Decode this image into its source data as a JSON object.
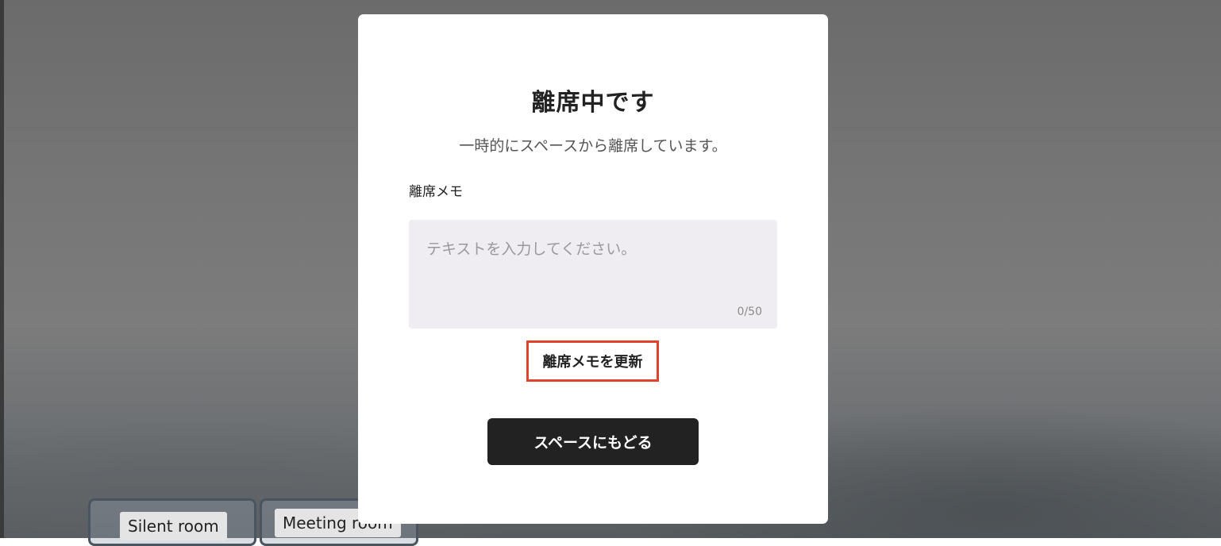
{
  "background": {
    "rooms": [
      {
        "label": "Silent room"
      },
      {
        "label": "Meeting room"
      }
    ]
  },
  "modal": {
    "title": "離席中です",
    "subtitle": "一時的にスペースから離席しています。",
    "memo": {
      "label": "離席メモ",
      "value": "",
      "placeholder": "テキストを入力してください。",
      "counter": "0/50"
    },
    "update_label": "離席メモを更新",
    "return_label": "スペースにもどる"
  },
  "colors": {
    "highlight_border": "#e0422b",
    "primary_button": "#222222",
    "input_background": "#efedf1"
  }
}
